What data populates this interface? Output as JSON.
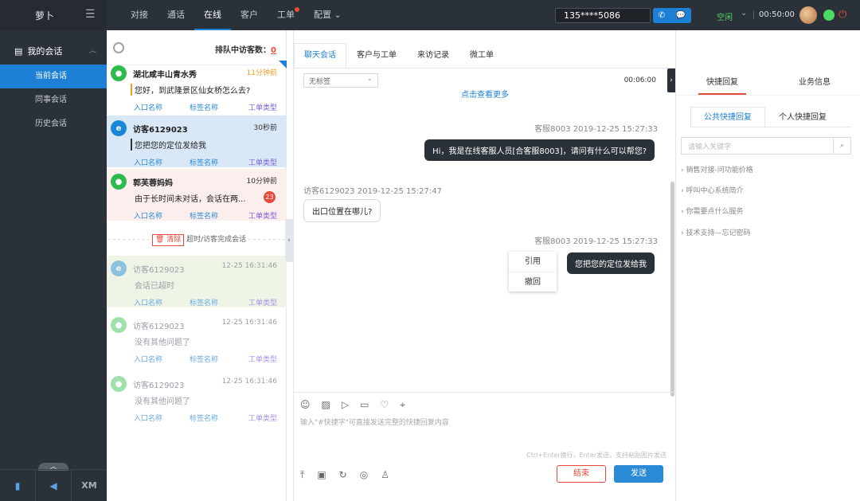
{
  "topbar": {
    "brand": "萝卜",
    "nav": [
      {
        "label": "对接"
      },
      {
        "label": "通话"
      },
      {
        "label": "在线"
      },
      {
        "label": "客户"
      },
      {
        "label": "工单"
      },
      {
        "label": "配置"
      }
    ],
    "phone": "135****5086",
    "status": "空闲",
    "timer": "00:50:00"
  },
  "sidebar": {
    "header": "我的会话",
    "items": [
      {
        "label": "当前会话"
      },
      {
        "label": "同事会话"
      },
      {
        "label": "历史会话"
      }
    ],
    "bottom_label": "XM"
  },
  "list": {
    "queue_label": "排队中访客数：",
    "queue_count": "0",
    "conversations": [
      {
        "name": "湖北咸丰山青水秀",
        "time": "11分钟前",
        "message": "您好，到武隆景区仙女桥怎么去?",
        "tag1": "入口名称",
        "tag2": "标签名称",
        "tag3": "工单类型"
      },
      {
        "name": "访客6129023",
        "time": "30秒前",
        "message": "您把您的定位发给我",
        "tag1": "入口名称",
        "tag2": "标签名称",
        "tag3": "工单类型"
      },
      {
        "name": "郭芙蓉妈妈",
        "time": "10分钟前",
        "message": "由于长时间未对话，会话在两...",
        "badge": "23",
        "tag1": "入口名称",
        "tag2": "标签名称",
        "tag3": "工单类型"
      },
      {
        "name": "访客6129023",
        "time": "12-25 16:31:46",
        "message": "会话已超时",
        "tag1": "入口名称",
        "tag2": "标签名称",
        "tag3": "工单类型"
      },
      {
        "name": "访客6129023",
        "time": "12-25 16:31:46",
        "message": "没有其他问题了",
        "tag1": "入口名称",
        "tag2": "标签名称",
        "tag3": "工单类型"
      },
      {
        "name": "访客6129023",
        "time": "12-25 16:31:46",
        "message": "没有其他问题了",
        "tag1": "入口名称",
        "tag2": "标签名称",
        "tag3": "工单类型"
      }
    ],
    "divider_clear": "清除",
    "divider_text": "超时/访客完成会话"
  },
  "chat": {
    "tabs": [
      {
        "label": "聊天会话"
      },
      {
        "label": "客户与工单"
      },
      {
        "label": "来访记录"
      },
      {
        "label": "微工单"
      }
    ],
    "tag_select": "无标签",
    "duration": "00:06:00",
    "load_more": "点击查看更多",
    "messages": [
      {
        "stamp": "客服8003 2019-12-25 15:27:33",
        "text": "Hi，我是在线客服人员[合客服8003]，请问有什么可以帮您?"
      },
      {
        "stamp": "访客6129023 2019-12-25 15:27:47",
        "text": "出口位置在哪儿?"
      },
      {
        "stamp": "客服8003 2019-12-25 15:27:33",
        "text": "您把您的定位发给我"
      }
    ],
    "context_menu": [
      "引用",
      "撤回"
    ],
    "input_hint": "输入\"#快捷字\"可直接发送完整的快捷回复内容",
    "shortcut_hint": "Ctrl+Enter换行，Enter发送，支持粘贴图片发送",
    "end_button": "结束",
    "send_button": "发送"
  },
  "right": {
    "tabs": [
      {
        "label": "快捷回复"
      },
      {
        "label": "业务信息"
      }
    ],
    "subtabs": [
      {
        "label": "公共快捷回复"
      },
      {
        "label": "个人快捷回复"
      }
    ],
    "search_placeholder": "请输入关键字",
    "items": [
      {
        "label": "销售对接-问功能价格"
      },
      {
        "label": "呼叫中心系统简介"
      },
      {
        "label": "你需要点什么服务"
      },
      {
        "label": "技术支持—忘记密码"
      }
    ]
  }
}
